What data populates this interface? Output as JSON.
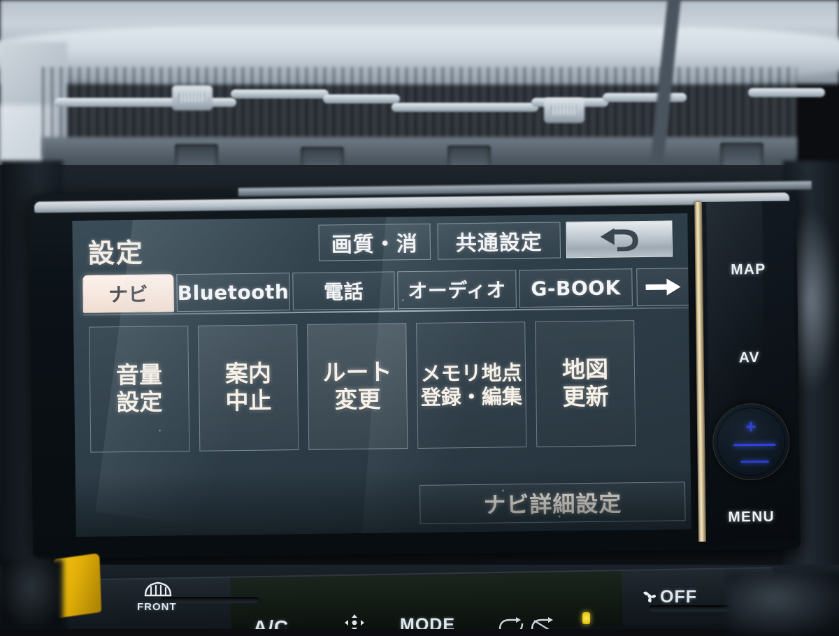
{
  "device": {
    "name": "toyota-nsdn-navigation-head-unit",
    "screen_bg_color": "#2e3f4a",
    "accent_active_tab_color": "#f7e6dc",
    "knob_led_color": "#2f44d8"
  },
  "screen": {
    "title": "設定",
    "header_buttons": [
      {
        "label": "画質・消",
        "name": "picture-quality-button"
      },
      {
        "label": "共通設定",
        "name": "common-settings-button"
      }
    ],
    "back_button": {
      "icon": "back-arrow-icon",
      "label": ""
    },
    "tabs": [
      {
        "label": "ナビ",
        "active": true
      },
      {
        "label": "Bluetooth",
        "active": false
      },
      {
        "label": "電話",
        "active": false
      },
      {
        "label": "オーディオ",
        "active": false
      },
      {
        "label": "G-BOOK",
        "active": false
      }
    ],
    "tab_next": {
      "icon": "right-arrow-icon"
    },
    "grid_buttons": [
      {
        "line1": "音量",
        "line2": "設定"
      },
      {
        "line1": "案内",
        "line2": "中止"
      },
      {
        "line1": "ルート",
        "line2": "変更"
      },
      {
        "line1": "メモリ地点",
        "line2": "登録・編集"
      },
      {
        "line1": "地図",
        "line2": "更新"
      }
    ],
    "detail_button": {
      "label": "ナビ詳細設定"
    }
  },
  "hard_keys": {
    "map": "MAP",
    "av": "AV",
    "menu": "MENU",
    "volume_knob": {
      "plus": "+",
      "minus": "−",
      "name": "volume-knob"
    }
  },
  "hvac": {
    "front_defrost": "FRONT",
    "ac": "A/C",
    "mode": "MODE",
    "off": "OFF"
  }
}
